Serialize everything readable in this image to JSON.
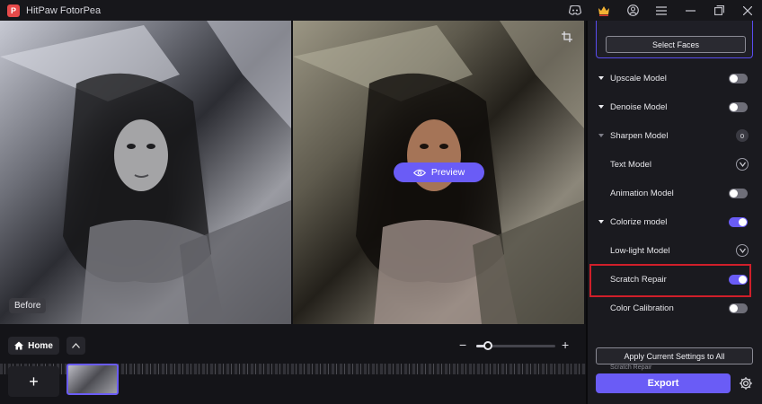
{
  "titlebar": {
    "app_title": "HitPaw FotorPea",
    "logo_letter": "P",
    "icons": [
      "discord-icon",
      "crown-icon",
      "account-icon",
      "menu-icon",
      "minimize-icon",
      "restore-icon",
      "close-icon"
    ]
  },
  "canvas": {
    "before_label": "Before",
    "preview_label": "Preview"
  },
  "bottom": {
    "home_label": "Home",
    "zoom_minus": "−",
    "zoom_plus": "+",
    "zoom_level": 0.15,
    "add_label": "+"
  },
  "panel": {
    "select_faces_label": "Select Faces",
    "models": [
      {
        "label": "Upscale Model",
        "caret": "expanded",
        "control": "toggle",
        "on": false
      },
      {
        "label": "Denoise Model",
        "caret": "expanded",
        "control": "toggle",
        "on": false
      },
      {
        "label": "Sharpen Model",
        "caret": "dim",
        "control": "count",
        "count": "0"
      },
      {
        "label": "Text Model",
        "caret": "none",
        "control": "download"
      },
      {
        "label": "Animation Model",
        "caret": "none",
        "control": "toggle",
        "on": false
      },
      {
        "label": "Colorize model",
        "caret": "expanded",
        "control": "toggle",
        "on": true
      },
      {
        "label": "Low-light Model",
        "caret": "none",
        "control": "download"
      },
      {
        "label": "Scratch Repair",
        "caret": "none",
        "control": "toggle",
        "on": true
      },
      {
        "label": "Color Calibration",
        "caret": "none",
        "control": "toggle",
        "on": false
      }
    ],
    "apply_label": "Apply Current Settings to All",
    "overlap_label": "Scratch Repair",
    "export_label": "Export"
  },
  "colors": {
    "accent": "#6a5cf6",
    "highlight": "#d01f2a"
  }
}
